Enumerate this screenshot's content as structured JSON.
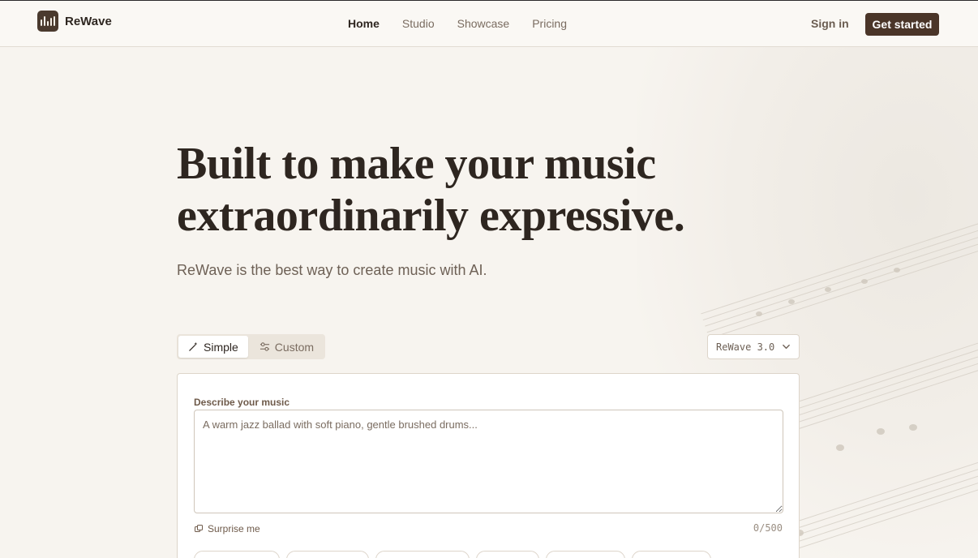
{
  "brand": {
    "name": "ReWave",
    "icon": "equalizer-bars-icon"
  },
  "nav": {
    "items": [
      {
        "label": "Home",
        "active": true
      },
      {
        "label": "Studio",
        "active": false
      },
      {
        "label": "Showcase",
        "active": false
      },
      {
        "label": "Pricing",
        "active": false
      }
    ],
    "signin_label": "Sign in",
    "cta_label": "Get started"
  },
  "hero": {
    "title_line1": "Built to make your music",
    "title_line2": "extraordinarily expressive.",
    "subtitle": "ReWave is the best way to create music with AI."
  },
  "mode_toggle": {
    "simple_label": "Simple",
    "custom_label": "Custom",
    "selected": "Simple"
  },
  "model_select": {
    "value": "ReWave 3.0"
  },
  "composer": {
    "label": "Describe your music",
    "placeholder": "A warm jazz ballad with soft piano, gentle brushed drums...",
    "value": "",
    "surprise_label": "Surprise me",
    "counter": "0/500"
  },
  "colors": {
    "background": "#f7f4ef",
    "accent": "#4a3528",
    "text": "#2e2620",
    "muted": "#7a6c60"
  }
}
